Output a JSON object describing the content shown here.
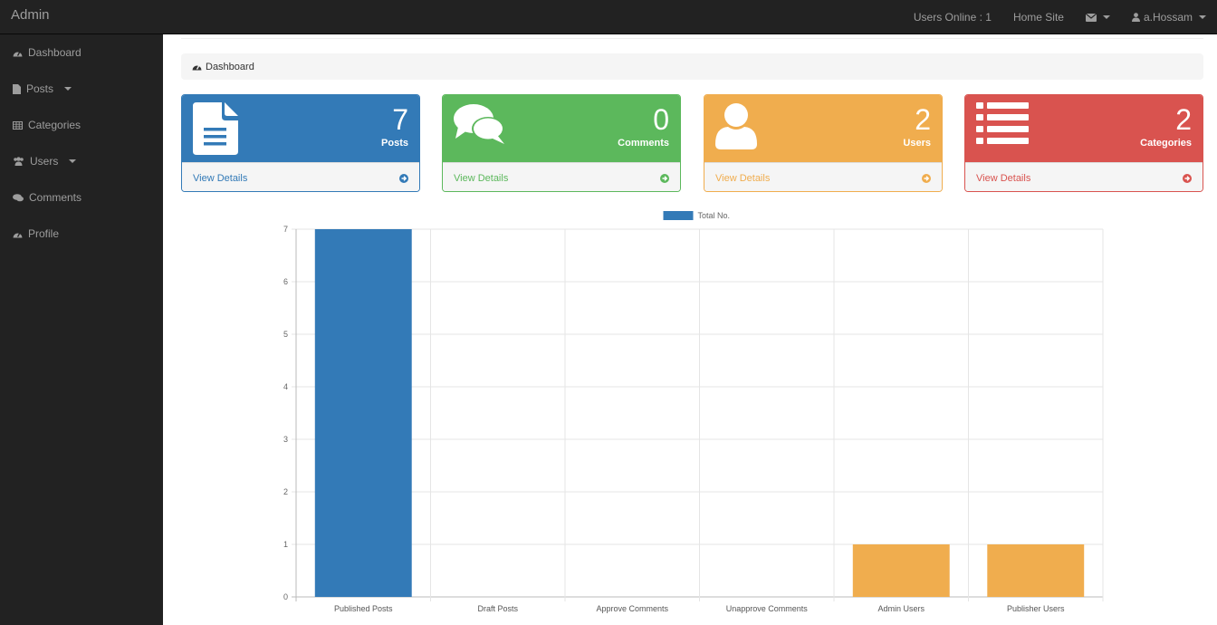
{
  "navbar": {
    "brand": "Admin",
    "users_online": "Users Online : 1",
    "home_site": "Home Site",
    "user_name": "a.Hossam"
  },
  "sidebar": {
    "items": [
      {
        "label": "Dashboard",
        "icon": "dashboard-icon"
      },
      {
        "label": "Posts",
        "icon": "file-icon",
        "dropdown": true
      },
      {
        "label": "Categories",
        "icon": "table-icon"
      },
      {
        "label": "Users",
        "icon": "users-icon",
        "dropdown": true
      },
      {
        "label": "Comments",
        "icon": "comments-icon"
      },
      {
        "label": "Profile",
        "icon": "dashboard-icon"
      }
    ]
  },
  "breadcrumb": {
    "label": "Dashboard",
    "icon": "dashboard-icon"
  },
  "panels": [
    {
      "count": "7",
      "label": "Posts",
      "link": "View Details",
      "color": "#337ab7",
      "icon": "file-text-icon"
    },
    {
      "count": "0",
      "label": "Comments",
      "link": "View Details",
      "color": "#5cb85c",
      "icon": "comments-icon"
    },
    {
      "count": "2",
      "label": "Users",
      "link": "View Details",
      "color": "#f0ad4e",
      "icon": "user-icon"
    },
    {
      "count": "2",
      "label": "Categories",
      "link": "View Details",
      "color": "#d9534f",
      "icon": "list-icon"
    }
  ],
  "chart_data": {
    "type": "bar",
    "legend": "Total No.",
    "categories": [
      "Published Posts",
      "Draft Posts",
      "Approve Comments",
      "Unapprove Comments",
      "Admin Users",
      "Publisher Users"
    ],
    "values": [
      7,
      0,
      0,
      0,
      1,
      1
    ],
    "colors": [
      "#337ab7",
      "#337ab7",
      "#5cb85c",
      "#5cb85c",
      "#f0ad4e",
      "#f0ad4e"
    ],
    "ylim": [
      0,
      7
    ],
    "yticks": [
      "0",
      "1",
      "2",
      "3",
      "4",
      "5",
      "6",
      "7"
    ],
    "grid": true,
    "legend_position": "top"
  }
}
